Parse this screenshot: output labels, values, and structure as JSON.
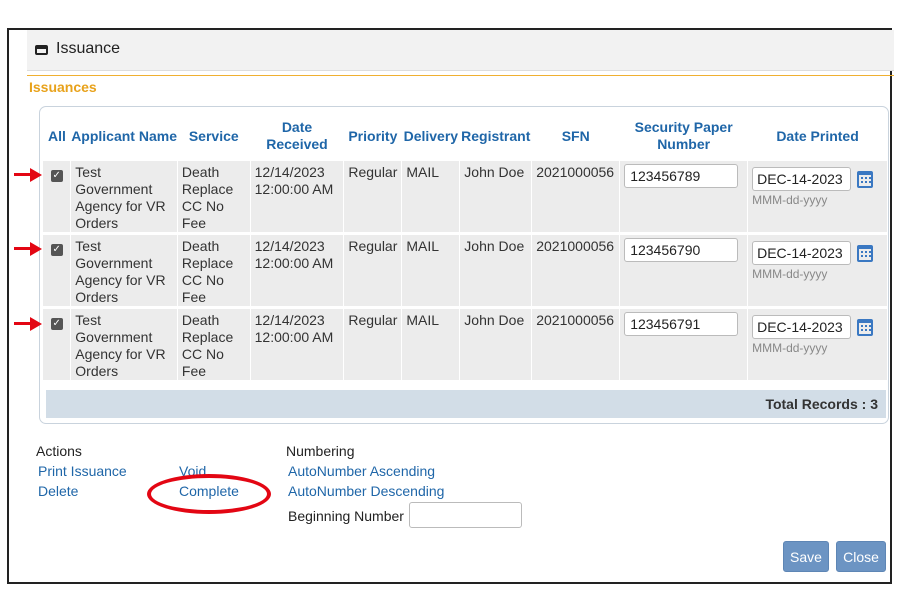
{
  "window": {
    "title": "Issuance",
    "icon": "window-icon"
  },
  "section_title": "Issuances",
  "table": {
    "headers": {
      "all": "All",
      "applicant": "Applicant Name",
      "service": "Service",
      "date_received": "Date Received",
      "priority": "Priority",
      "delivery": "Delivery",
      "registrant": "Registrant",
      "sfn": "SFN",
      "security_paper": "Security Paper Number",
      "date_printed": "Date Printed"
    },
    "rows": [
      {
        "checked": true,
        "applicant": "Test Government Agency for VR Orders",
        "service": "Death Replace CC No Fee",
        "date_received": "12/14/2023 12:00:00 AM",
        "priority": "Regular",
        "delivery": "MAIL",
        "registrant": "John Doe",
        "sfn": "2021000056",
        "security_paper": "123456789",
        "date_printed": "DEC-14-2023",
        "date_hint": "MMM-dd-yyyy"
      },
      {
        "checked": true,
        "applicant": "Test Government Agency for VR Orders",
        "service": "Death Replace CC No Fee",
        "date_received": "12/14/2023 12:00:00 AM",
        "priority": "Regular",
        "delivery": "MAIL",
        "registrant": "John Doe",
        "sfn": "2021000056",
        "security_paper": "123456790",
        "date_printed": "DEC-14-2023",
        "date_hint": "MMM-dd-yyyy"
      },
      {
        "checked": true,
        "applicant": "Test Government Agency for VR Orders",
        "service": "Death Replace CC No Fee",
        "date_received": "12/14/2023 12:00:00 AM",
        "priority": "Regular",
        "delivery": "MAIL",
        "registrant": "John Doe",
        "sfn": "2021000056",
        "security_paper": "123456791",
        "date_printed": "DEC-14-2023",
        "date_hint": "MMM-dd-yyyy"
      }
    ],
    "total_records": "Total Records : 3"
  },
  "actions": {
    "label": "Actions",
    "print_issuance": "Print Issuance",
    "delete": "Delete",
    "void": "Void",
    "complete": "Complete"
  },
  "numbering": {
    "label": "Numbering",
    "ascending": "AutoNumber Ascending",
    "descending": "AutoNumber Descending",
    "beginning_label": "Beginning Number",
    "beginning_value": ""
  },
  "buttons": {
    "save": "Save",
    "close": "Close"
  },
  "colors": {
    "link": "#1f66a8",
    "section_title": "#e8a21b",
    "annotation": "#e30613",
    "button": "#6c94c3",
    "total_bar": "#d2dde7"
  }
}
